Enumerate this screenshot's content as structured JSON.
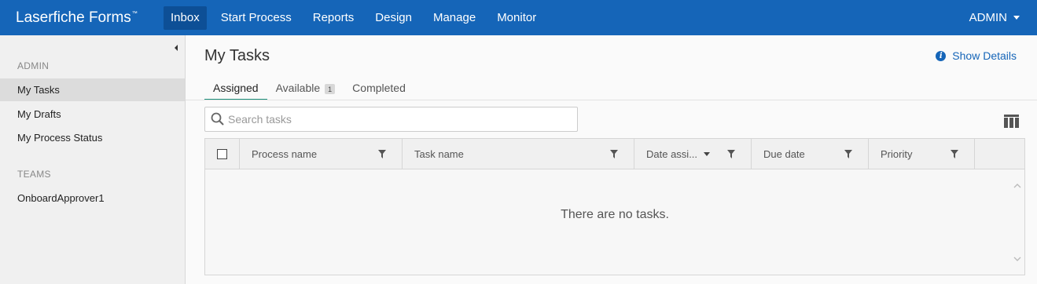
{
  "header": {
    "brand": "Laserfiche Forms",
    "brand_tm": "™",
    "nav": [
      "Inbox",
      "Start Process",
      "Reports",
      "Design",
      "Manage",
      "Monitor"
    ],
    "active_nav": "Inbox",
    "user": "ADMIN"
  },
  "sidebar": {
    "section_user": "ADMIN",
    "items": [
      "My Tasks",
      "My Drafts",
      "My Process Status"
    ],
    "section_teams": "TEAMS",
    "teams": [
      "OnboardApprover1"
    ]
  },
  "main": {
    "title": "My Tasks",
    "show_details": "Show Details",
    "tabs": {
      "assigned": "Assigned",
      "available": "Available",
      "available_count": "1",
      "completed": "Completed"
    },
    "search_placeholder": "Search tasks",
    "columns": {
      "process_name": "Process name",
      "task_name": "Task name",
      "date_assigned": "Date assi...",
      "due_date": "Due date",
      "priority": "Priority"
    },
    "empty_message": "There are no tasks."
  },
  "colors": {
    "topbar": "#1565b8",
    "active_nav": "#0d4f96",
    "tab_underline": "#1b8f7a",
    "link": "#1565b8"
  },
  "icons": [
    "info-icon",
    "search-icon",
    "columns-icon",
    "filter-icon",
    "sort-desc-icon",
    "collapse-icon",
    "scroll-up-icon",
    "scroll-down-icon",
    "caret-down-icon"
  ]
}
